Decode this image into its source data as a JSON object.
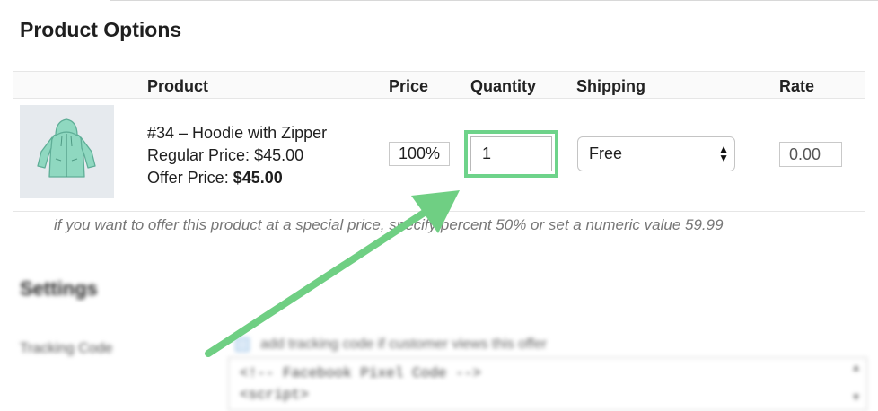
{
  "section_title": "Product Options",
  "columns": {
    "product": "Product",
    "price": "Price",
    "quantity": "Quantity",
    "shipping": "Shipping",
    "rate": "Rate"
  },
  "product": {
    "image_icon": "hoodie-icon",
    "name": "#34 – Hoodie with Zipper",
    "regular_price_label": "Regular Price:",
    "regular_price": "$45.00",
    "offer_price_label": "Offer Price:",
    "offer_price": "$45.00"
  },
  "row": {
    "price_value": "100%",
    "quantity_value": "1",
    "shipping_value": "Free",
    "rate_value": "0.00"
  },
  "hint": "if you want to offer this product at a special price, specify percent 50% or set a numeric value 59.99",
  "settings": {
    "title": "Settings",
    "tracking_label": "Tracking Code",
    "tracking_checkbox_label": "add tracking code if customer views this offer",
    "code_line1": "<!-- Facebook Pixel Code -->",
    "code_line2": "<script>"
  },
  "colors": {
    "highlight": "#6ed38a",
    "arrow": "#6fcf83",
    "hoodie": "#8fd8c0"
  }
}
